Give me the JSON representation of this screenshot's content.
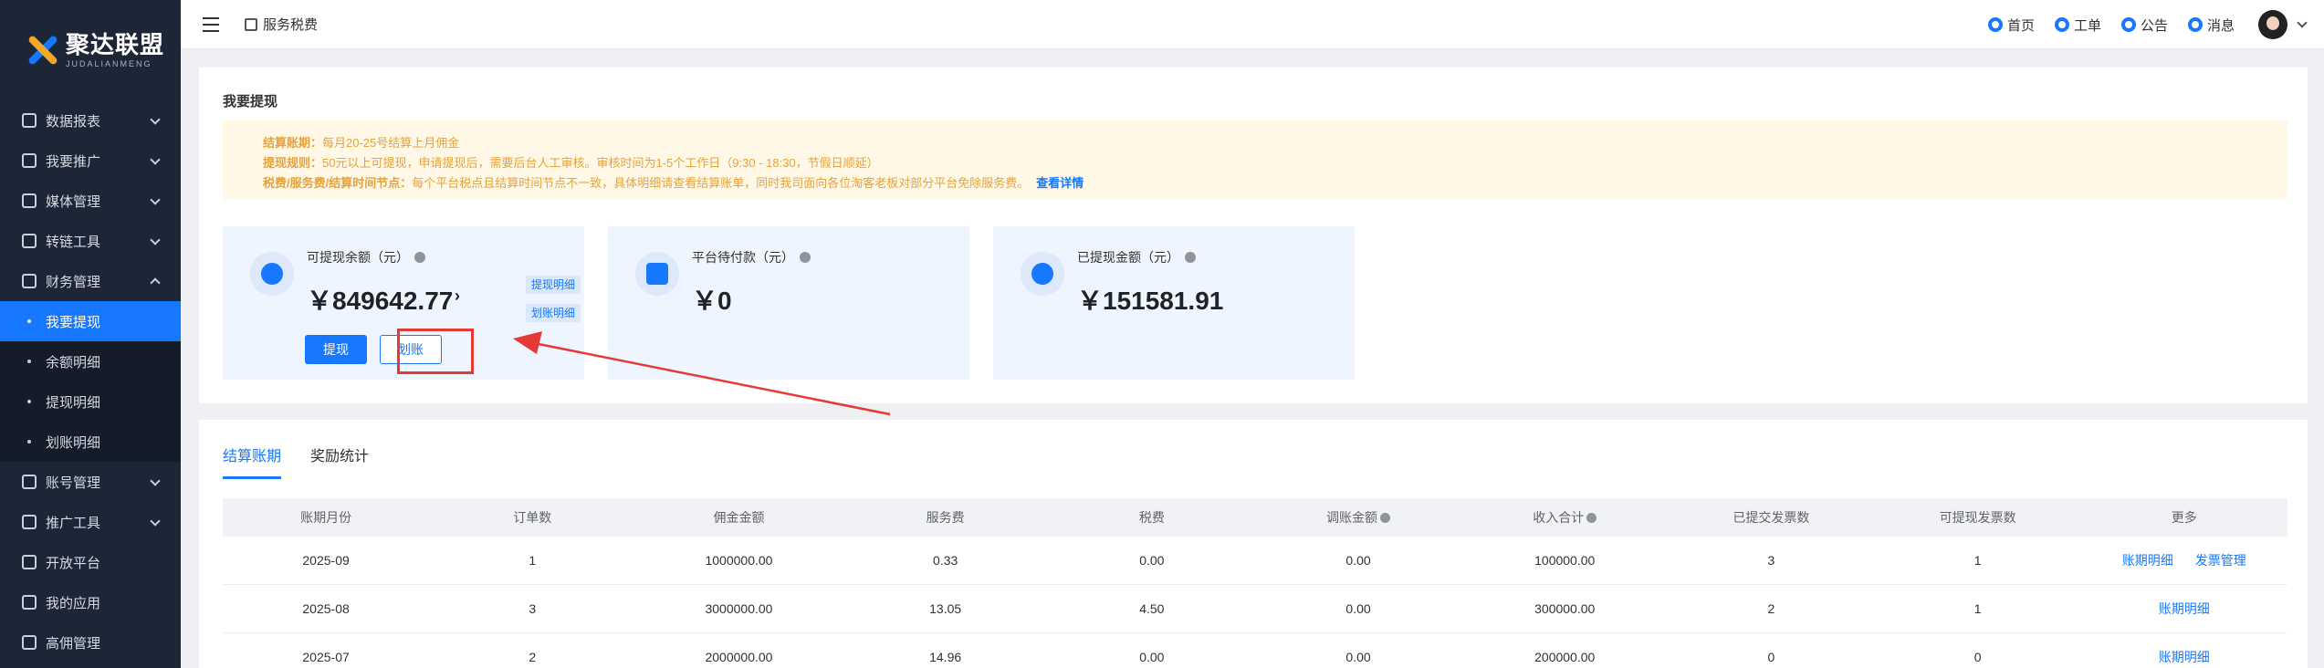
{
  "brand": {
    "name": "聚达联盟",
    "sub": "JUDALIANMENG"
  },
  "sidebar": {
    "items": [
      {
        "label": "数据报表",
        "icon": "chart-icon"
      },
      {
        "label": "我要推广",
        "icon": "megaphone-icon"
      },
      {
        "label": "媒体管理",
        "icon": "media-icon"
      },
      {
        "label": "转链工具",
        "icon": "link-icon"
      },
      {
        "label": "财务管理",
        "icon": "finance-icon",
        "expanded": true
      }
    ],
    "finance_sub": [
      {
        "label": "我要提现",
        "active": true
      },
      {
        "label": "余额明细"
      },
      {
        "label": "提现明细"
      },
      {
        "label": "划账明细"
      }
    ],
    "items2": [
      {
        "label": "账号管理",
        "icon": "account-icon"
      },
      {
        "label": "推广工具",
        "icon": "toolbox-icon"
      },
      {
        "label": "开放平台",
        "icon": "code-icon"
      },
      {
        "label": "我的应用",
        "icon": "app-icon"
      },
      {
        "label": "高佣管理",
        "icon": "commission-icon"
      }
    ]
  },
  "topbar": {
    "breadcrumb": "服务税费",
    "links": [
      {
        "label": "首页",
        "icon": "home-icon"
      },
      {
        "label": "工单",
        "icon": "ticket-icon"
      },
      {
        "label": "公告",
        "icon": "notice-icon"
      },
      {
        "label": "消息",
        "icon": "message-icon"
      }
    ]
  },
  "withdraw": {
    "title": "我要提现",
    "notice": [
      {
        "key": "结算账期：",
        "text": "每月20-25号结算上月佣金"
      },
      {
        "key": "提现规则：",
        "text": "50元以上可提现，申请提现后，需要后台人工审核。审核时间为1-5个工作日（9:30 - 18:30，节假日顺延）"
      },
      {
        "key": "税费/服务费/结算时间节点：",
        "text": "每个平台税点且结算时间节点不一致，具体明细请查看结算账单，同时我司面向各位淘客老板对部分平台免除服务费。"
      }
    ],
    "notice_link": "查看详情",
    "cards": [
      {
        "label": "可提现余额（元）",
        "amount": "￥849642.77",
        "arrow": "›",
        "tags": [
          "提现明细",
          "划账明细"
        ],
        "btn_withdraw": "提现",
        "btn_transfer": "划账"
      },
      {
        "label": "平台待付款（元）",
        "amount": "￥0"
      },
      {
        "label": "已提现金额（元）",
        "amount": "￥151581.91"
      }
    ]
  },
  "accent": "#1677ff",
  "highlight": "#e53935",
  "tabs": [
    {
      "label": "结算账期",
      "active": true
    },
    {
      "label": "奖励统计"
    }
  ],
  "table": {
    "headers": [
      "账期月份",
      "订单数",
      "佣金金额",
      "服务费",
      "税费",
      "调账金额",
      "收入合计",
      "已提交发票数",
      "可提现发票数",
      "更多"
    ],
    "rows": [
      {
        "cells": [
          "2025-09",
          "1",
          "1000000.00",
          "0.33",
          "0.00",
          "0.00",
          "100000.00",
          "3",
          "1"
        ],
        "links": [
          "账期明细",
          "发票管理"
        ]
      },
      {
        "cells": [
          "2025-08",
          "3",
          "3000000.00",
          "13.05",
          "4.50",
          "0.00",
          "300000.00",
          "2",
          "1"
        ],
        "links": [
          "账期明细"
        ]
      },
      {
        "cells": [
          "2025-07",
          "2",
          "2000000.00",
          "14.96",
          "0.00",
          "0.00",
          "200000.00",
          "0",
          "0"
        ],
        "links": [
          "账期明细"
        ]
      }
    ]
  }
}
